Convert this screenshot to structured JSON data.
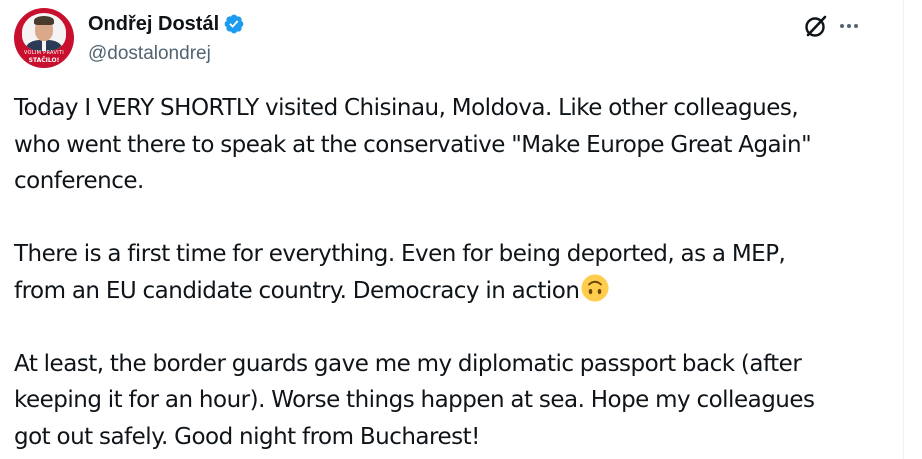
{
  "author": {
    "display_name": "Ondřej Dostál",
    "handle": "@dostalondrej",
    "verified": true,
    "verified_color": "#1d9bf0",
    "avatar": {
      "badge_line1": "VOLIM PRAVITI",
      "badge_line2": "STAČILO!",
      "bg_color": "#c8102e"
    }
  },
  "actions": {
    "grok_icon": "grok-icon",
    "more_icon": "more-icon",
    "more_label": "···"
  },
  "tweet": {
    "lines_p1": [
      "Today I VERY SHORTLY visited Chisinau, Moldova. Like other colleagues,",
      "who went there to speak at the conservative \"Make Europe Great Again\"",
      "conference."
    ],
    "lines_p2": [
      "There is a first time for everything. Even for being deported, as a MEP,",
      "from an EU candidate country. Democracy in action"
    ],
    "emoji": "upside-down-face",
    "lines_p3": [
      "At least, the border guards gave me my diplomatic passport back (after",
      "keeping it for an hour). Worse things happen at sea. Hope my colleagues",
      "got out safely. Good night from Bucharest!"
    ]
  }
}
